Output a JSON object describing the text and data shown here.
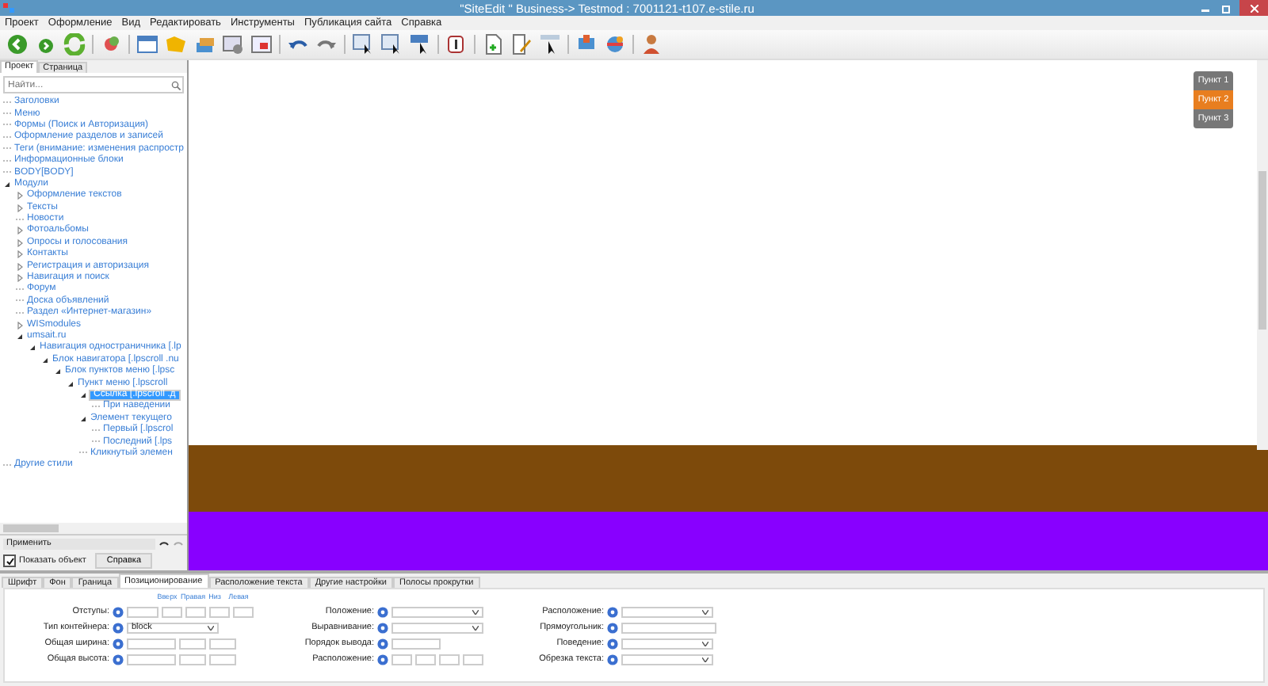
{
  "window": {
    "title": "\"SiteEdit \" Business-> Testmod : 7001121-t107.e-stile.ru"
  },
  "menu": [
    "Проект",
    "Оформление",
    "Вид",
    "Редактировать",
    "Инструменты",
    "Публикация сайта",
    "Справка"
  ],
  "left_panel": {
    "tabs": [
      {
        "label": "Проект",
        "selected": true
      },
      {
        "label": "Страница",
        "selected": false
      }
    ],
    "search": {
      "placeholder": "Найти..."
    },
    "tree": [
      {
        "label": "Заголовки"
      },
      {
        "label": "Меню"
      },
      {
        "label": "Формы (Поиск и Авторизация)"
      },
      {
        "label": "Оформление разделов и записей"
      },
      {
        "label": "Теги (внимание: изменения распростр"
      },
      {
        "label": "Информационные блоки"
      },
      {
        "label": "BODY[BODY]"
      },
      {
        "label": "Модули",
        "expanded": true,
        "children": [
          {
            "label": "Оформление текстов",
            "expanded": false
          },
          {
            "label": "Тексты",
            "expanded": false
          },
          {
            "label": "Новости"
          },
          {
            "label": "Фотоальбомы",
            "expanded": false
          },
          {
            "label": "Опросы и голосования",
            "expanded": false
          },
          {
            "label": "Контакты",
            "expanded": false
          },
          {
            "label": "Регистрация и авторизация",
            "expanded": false
          },
          {
            "label": "Навигация и поиск",
            "expanded": false
          },
          {
            "label": "Форум"
          },
          {
            "label": "Доска объявлений"
          },
          {
            "label": "Раздел «Интернет-магазин»"
          },
          {
            "label": "WISmodules",
            "expanded": false
          },
          {
            "label": "umsait.ru",
            "expanded": true,
            "children": [
              {
                "label": "Навигация одностраничника [.lp",
                "expanded": true,
                "children": [
                  {
                    "label": "Блок навигатора [.lpscroll .nu",
                    "expanded": true,
                    "children": [
                      {
                        "label": "Блок пунктов меню [.lpsc",
                        "expanded": true,
                        "children": [
                          {
                            "label": "Пункт меню [.lpscroll",
                            "expanded": true,
                            "children": [
                              {
                                "label": "Ссылка [.lpscroll .д",
                                "expanded": true,
                                "selected": true,
                                "children": [
                                  {
                                    "label": "При наведении"
                                  }
                                ]
                              },
                              {
                                "label": "Элемент текущего",
                                "expanded": true,
                                "children": [
                                  {
                                    "label": "Первый [.lpscrol"
                                  },
                                  {
                                    "label": "Последний [.lps"
                                  }
                                ]
                              },
                              {
                                "label": "Кликнутый элемен"
                              }
                            ]
                          }
                        ]
                      }
                    ]
                  }
                ]
              }
            ]
          }
        ]
      },
      {
        "label": "Другие стили"
      }
    ],
    "apply": "Применить",
    "show_object": {
      "label": "Показать объект",
      "checked": true
    },
    "help_button": "Справка"
  },
  "canvas": {
    "nav_items": [
      {
        "label": "Пункт 1",
        "selected": false
      },
      {
        "label": "Пункт 2",
        "selected": true
      },
      {
        "label": "Пункт 3",
        "selected": false
      }
    ]
  },
  "properties": {
    "tabs": [
      {
        "label": "Шрифт",
        "selected": false
      },
      {
        "label": "Фон",
        "selected": false
      },
      {
        "label": "Граница",
        "selected": false
      },
      {
        "label": "Позиционирование",
        "selected": true
      },
      {
        "label": "Расположение текста",
        "selected": false
      },
      {
        "label": "Другие настройки",
        "selected": false
      },
      {
        "label": "Полосы прокрутки",
        "selected": false
      }
    ],
    "side_labels": [
      "Вверх",
      "Правая",
      "Низ",
      "Левая"
    ],
    "columns": [
      [
        {
          "label": "Отступы:",
          "kind": "margins"
        },
        {
          "label": "Тип контейнера:",
          "kind": "select",
          "value": "block"
        },
        {
          "label": "Общая ширина:",
          "kind": "size"
        },
        {
          "label": "Общая высота:",
          "kind": "size"
        }
      ],
      [
        {
          "label": "Положение:",
          "kind": "select"
        },
        {
          "label": "Выравнивание:",
          "kind": "select"
        },
        {
          "label": "Порядок вывода:",
          "kind": "short"
        },
        {
          "label": "Расположение:",
          "kind": "sides"
        }
      ],
      [
        {
          "label": "Расположение:",
          "kind": "select"
        },
        {
          "label": "Прямоугольник:",
          "kind": "input"
        },
        {
          "label": "Поведение:",
          "kind": "select"
        },
        {
          "label": "Обрезка текста:",
          "kind": "select"
        }
      ]
    ]
  }
}
